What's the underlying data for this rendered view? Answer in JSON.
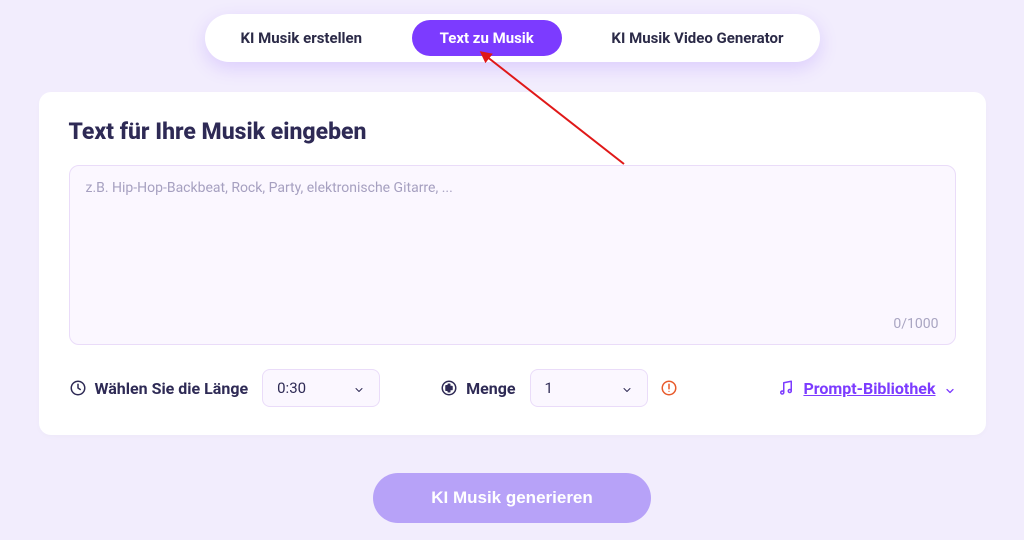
{
  "tabs": {
    "create": "KI Musik erstellen",
    "text2music": "Text zu Musik",
    "videogen": "KI Musik Video Generator"
  },
  "card": {
    "title": "Text für Ihre Musik eingeben",
    "placeholder": "z.B. Hip-Hop-Backbeat, Rock, Party, elektronische Gitarre, ...",
    "char_count": "0/1000"
  },
  "controls": {
    "length_label": "Wählen Sie die Länge",
    "length_value": "0:30",
    "amount_label": "Menge",
    "amount_value": "1",
    "library_label": "Prompt-Bibliothek"
  },
  "generate_label": "KI Musik generieren"
}
